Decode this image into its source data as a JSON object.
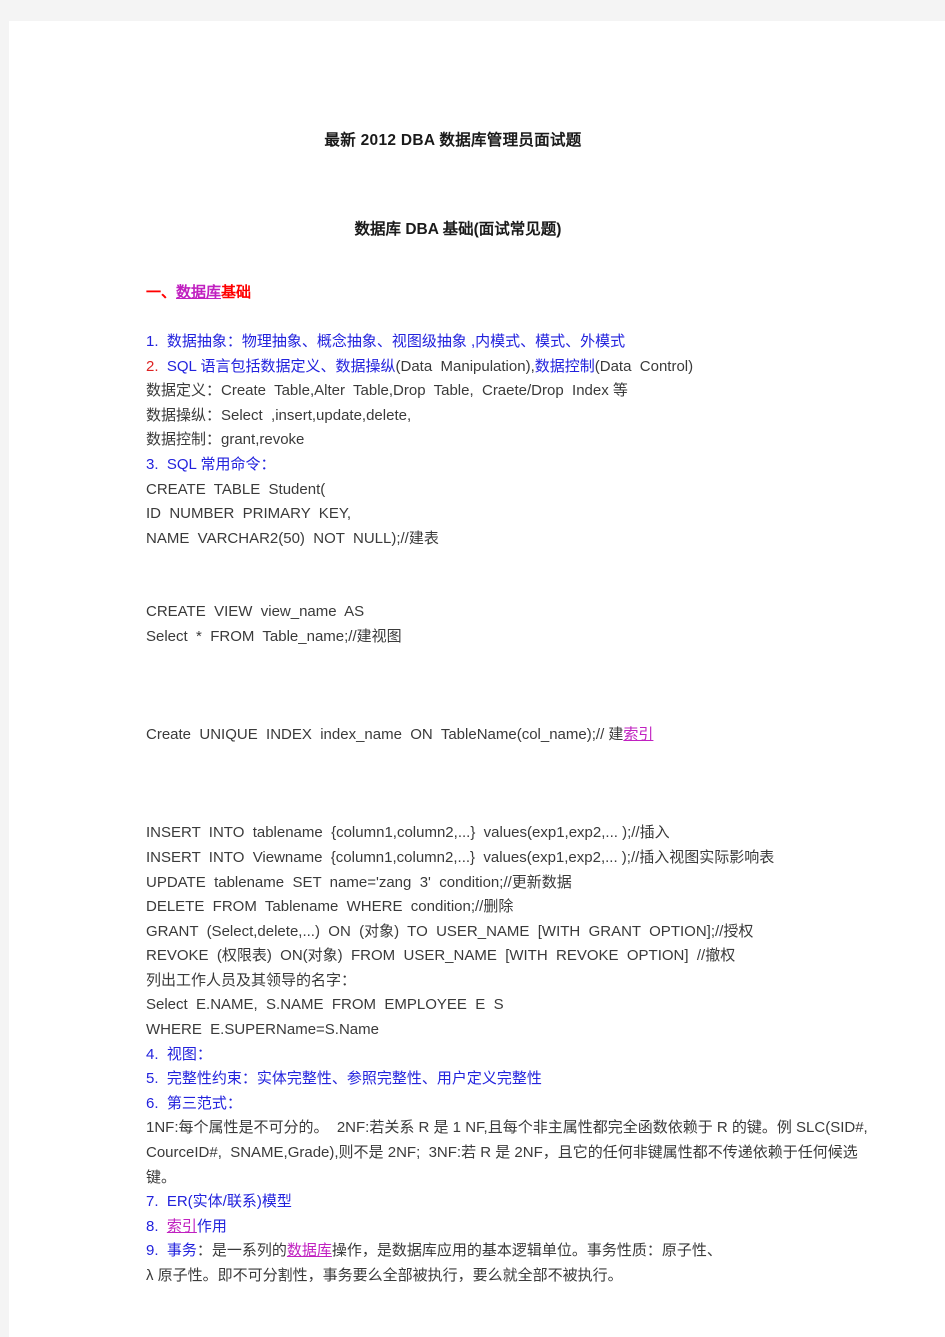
{
  "document": {
    "title": "最新 2012  DBA 数据库管理员面试题",
    "subtitle": "数据库 DBA 基础(面试常见题)",
    "section_heading": {
      "prefix": "一、",
      "link": "数据库",
      "suffix": "基础"
    },
    "colors": {
      "heading_red": "#ff0000",
      "item_blue": "#2222dd",
      "link_purple": "#c020c0",
      "body_dark": "#3a3a3a",
      "page_background": "#ffffff",
      "canvas_background": "#f4f4f4"
    },
    "lines": [
      {
        "id": "l1",
        "type": "text",
        "style": "blue",
        "text": "1.  数据抽象：物理抽象、概念抽象、视图级抽象 ,内模式、模式、外模式"
      },
      {
        "id": "l2",
        "type": "rich",
        "parts": [
          {
            "t": "2.  ",
            "c": "red-t"
          },
          {
            "t": "SQL 语言包括数据定义、数据操纵",
            "c": "blue-t"
          },
          {
            "t": "(Data  Manipulation),",
            "c": "dark-t"
          },
          {
            "t": "数据控制",
            "c": "blue-t"
          },
          {
            "t": "(Data  Control)",
            "c": "dark-t"
          }
        ]
      },
      {
        "id": "l3",
        "type": "text",
        "style": "dark",
        "text": "数据定义：Create  Table,Alter  Table,Drop  Table,  Craete/Drop  Index 等"
      },
      {
        "id": "l4",
        "type": "text",
        "style": "dark",
        "text": "数据操纵：Select  ,insert,update,delete,"
      },
      {
        "id": "l5",
        "type": "text",
        "style": "dark",
        "text": "数据控制：grant,revoke"
      },
      {
        "id": "l6",
        "type": "text",
        "style": "blue",
        "text": "3.  SQL 常用命令："
      },
      {
        "id": "l7",
        "type": "text",
        "style": "dark",
        "text": "CREATE  TABLE  Student("
      },
      {
        "id": "l8",
        "type": "text",
        "style": "dark",
        "text": "ID  NUMBER  PRIMARY  KEY,"
      },
      {
        "id": "l9",
        "type": "text",
        "style": "dark",
        "text": "NAME  VARCHAR2(50)  NOT  NULL);//建表"
      },
      {
        "id": "l10",
        "type": "tall-spacer"
      },
      {
        "id": "l11",
        "type": "text",
        "style": "dark",
        "text": "CREATE  VIEW  view_name  AS"
      },
      {
        "id": "l12",
        "type": "text",
        "style": "dark",
        "text": "Select  *  FROM  Table_name;//建视图"
      },
      {
        "id": "l13",
        "type": "tall-spacer"
      },
      {
        "id": "l14",
        "type": "spacer"
      },
      {
        "id": "l15",
        "type": "rich",
        "parts": [
          {
            "t": "Create  UNIQUE  INDEX  index_name  ON  TableName(col_name);// 建",
            "c": "dark-t"
          },
          {
            "t": "索引",
            "c": "lnk"
          }
        ]
      },
      {
        "id": "l16",
        "type": "tall-spacer"
      },
      {
        "id": "l17",
        "type": "spacer"
      },
      {
        "id": "l18",
        "type": "text",
        "style": "dark",
        "text": "INSERT  INTO  tablename  {column1,column2,...}  values(exp1,exp2,... );//插入"
      },
      {
        "id": "l19",
        "type": "text",
        "style": "dark",
        "text": "INSERT  INTO  Viewname  {column1,column2,...}  values(exp1,exp2,... );//插入视图实际影响表"
      },
      {
        "id": "l20",
        "type": "text",
        "style": "dark",
        "text": "UPDATE  tablename  SET  name='zang  3'  condition;//更新数据"
      },
      {
        "id": "l21",
        "type": "text",
        "style": "dark",
        "text": "DELETE  FROM  Tablename  WHERE  condition;//删除"
      },
      {
        "id": "l22",
        "type": "text",
        "style": "dark",
        "text": "GRANT  (Select,delete,...)  ON  (对象)  TO  USER_NAME  [WITH  GRANT  OPTION];//授权"
      },
      {
        "id": "l23",
        "type": "text",
        "style": "dark",
        "text": "REVOKE  (权限表)  ON(对象)  FROM  USER_NAME  [WITH  REVOKE  OPTION]  //撤权"
      },
      {
        "id": "l24",
        "type": "text",
        "style": "dark",
        "text": "列出工作人员及其领导的名字："
      },
      {
        "id": "l25",
        "type": "text",
        "style": "dark",
        "text": "Select  E.NAME,  S.NAME  FROM  EMPLOYEE  E  S"
      },
      {
        "id": "l26",
        "type": "text",
        "style": "dark",
        "text": "WHERE  E.SUPERName=S.Name"
      },
      {
        "id": "l27",
        "type": "text",
        "style": "blue",
        "text": "4.  视图："
      },
      {
        "id": "l28",
        "type": "text",
        "style": "blue",
        "text": "5.  完整性约束：实体完整性、参照完整性、用户定义完整性"
      },
      {
        "id": "l29",
        "type": "text",
        "style": "blue",
        "text": "6.  第三范式："
      },
      {
        "id": "l30",
        "type": "text",
        "style": "dark",
        "text": "1NF:每个属性是不可分的。  2NF:若关系 R 是 1 NF,且每个非主属性都完全函数依赖于 R 的键。例 SLC(SID#,  CourceID#,  SNAME,Grade),则不是 2NF;  3NF:若 R 是 2NF，且它的任何非键属性都不传递依赖于任何候选键。"
      },
      {
        "id": "l31",
        "type": "text",
        "style": "blue",
        "text": "7.  ER(实体/联系)模型"
      },
      {
        "id": "l32",
        "type": "rich",
        "parts": [
          {
            "t": "8.  ",
            "c": "blue-t"
          },
          {
            "t": "索引",
            "c": "lnk"
          },
          {
            "t": "作用",
            "c": "blue-t"
          }
        ]
      },
      {
        "id": "l33",
        "type": "rich",
        "parts": [
          {
            "t": "9.  事务",
            "c": "blue-t"
          },
          {
            "t": "：是一系列的",
            "c": "dark-t"
          },
          {
            "t": "数据库",
            "c": "lnk"
          },
          {
            "t": "操作，是数据库应用的基本逻辑单位。事务性质：原子性、",
            "c": "dark-t"
          }
        ]
      },
      {
        "id": "l34",
        "type": "rich",
        "parts": [
          {
            "t": "λ ",
            "c": "dark-t"
          },
          {
            "t": "原子性。即不可分割性，事务要么全部被执行，要么就全部不被执行。",
            "c": "dark-t"
          }
        ]
      }
    ]
  }
}
